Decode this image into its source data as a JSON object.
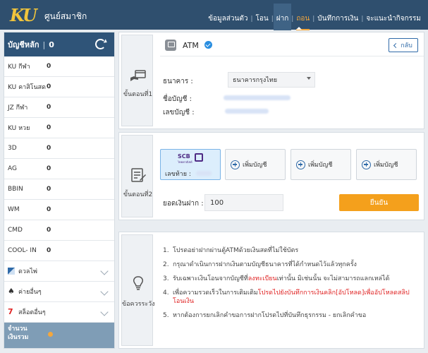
{
  "header": {
    "logo_text": "KU",
    "site_title": "ศูนย์สมาชิก",
    "nav": [
      {
        "label": "ข้อมูลส่วนตัว",
        "state": "normal"
      },
      {
        "label": "โอน",
        "state": "normal"
      },
      {
        "label": "ฝาก",
        "state": "hover"
      },
      {
        "label": "ถอน",
        "state": "active"
      },
      {
        "label": "บันทึกการเงิน",
        "state": "normal"
      },
      {
        "label": "จะแนะนำกิจกรรม",
        "state": "normal"
      }
    ]
  },
  "sidebar": {
    "main_label": "บัญชีหลัก",
    "main_value": "0",
    "balances": [
      {
        "label": "KU กีฬา",
        "value": "0"
      },
      {
        "label": "KU คาสิโนสด",
        "value": "0"
      },
      {
        "label": "JZ กีฬา",
        "value": "0"
      },
      {
        "label": "KU หวย",
        "value": "0"
      },
      {
        "label": "3D",
        "value": "0"
      },
      {
        "label": "AG",
        "value": "0"
      },
      {
        "label": "BBIN",
        "value": "0"
      },
      {
        "label": "WM",
        "value": "0"
      },
      {
        "label": "CMD",
        "value": "0"
      },
      {
        "label": "COOL- IN",
        "value": "0"
      }
    ],
    "groups": [
      {
        "label": "ดวลไพ่",
        "icon": "cards-icon"
      },
      {
        "label": "ค่ายอื่นๆ",
        "icon": "spade-icon"
      },
      {
        "label": "สล็อตอื่นๆ",
        "icon": "seven-icon"
      }
    ],
    "total_label_1": "จำนวน",
    "total_label_2": "เงินรวม"
  },
  "step1": {
    "step_label": "ขั้นตอนที่1",
    "method": "ATM",
    "back_label": "กลับ",
    "bank_label": "ธนาคาร :",
    "bank_value": "ธนาคารกรุงไทย",
    "account_name_label": "ชื่อบัญชี :",
    "account_number_label": "เลขบัญชี :"
  },
  "step2": {
    "step_label": "ขั้นตอนที่2",
    "selected_account": {
      "bank_logo": "SCB",
      "bank_logo_sub": "ไทยพาณิชย์",
      "tail_label": "เลขท้าย :"
    },
    "add_account_label": "เพิ่มบัญชี",
    "amount_label": "ยอดเงินฝาก :",
    "amount_value": "100",
    "confirm_label": "ยืนยัน"
  },
  "notes": {
    "step_label": "ข้อควรระวัง",
    "items": [
      {
        "num": "1.",
        "text": "โปรดอย่าฝากผ่านตู้ATMด้วยเงินสดที่ไม่ใช้บัตร",
        "red": ""
      },
      {
        "num": "2.",
        "text": "กรุณาดำเนินการฝากเงินตามบัญชีธนาคารที่ได้กำหนดไว้แล้วทุกครั้ง",
        "red": ""
      },
      {
        "num": "3.",
        "text_before": "รับเฉพาะเงินโอนจากบัญชีที่",
        "red": "ลงทะเบียน",
        "text_after": "เท่านั้น มิเช่นนั้น จะไม่สามารถแลกเหล่ได้"
      },
      {
        "num": "4.",
        "text_before": "เพื่อความรวดเร็วในการเติมเติม",
        "red": "โปรดไปยังบันทึกการเงินคลิก[อัปโหลด]เพื่ออัปโหลดสลิปโอนเงิน",
        "text_after": ""
      },
      {
        "num": "5.",
        "text": "หากต้องการยกเลิกคำขอการฝากโปรดไปที่บันทึกธุรกรรม - ยกเลิกคำขอ",
        "red": ""
      }
    ]
  },
  "colors": {
    "header_bg": "#2f4f6e",
    "accent": "#f4a01c",
    "link_blue": "#2f6aa8",
    "warning_red": "#e02424"
  }
}
